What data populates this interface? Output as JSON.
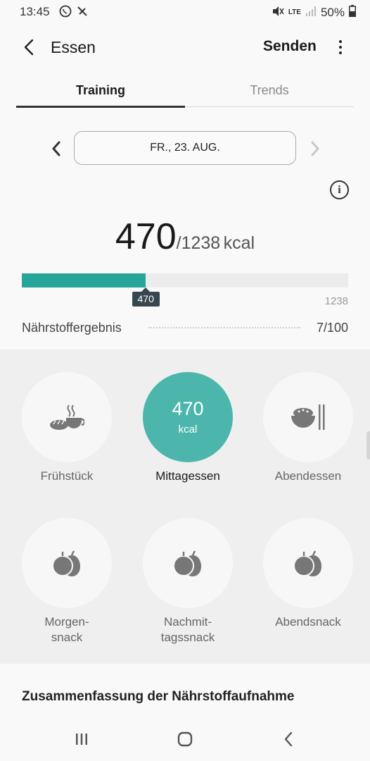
{
  "status_bar": {
    "time": "13:45",
    "battery": "50%",
    "network": "LTE"
  },
  "app_bar": {
    "title": "Essen",
    "send_label": "Senden"
  },
  "tabs": [
    {
      "label": "Training",
      "active": true
    },
    {
      "label": "Trends",
      "active": false
    }
  ],
  "date": {
    "label": "FR., 23. AUG."
  },
  "calories": {
    "consumed": "470",
    "goal": "/1238",
    "unit": "kcal",
    "marker_label": "470",
    "max_label": "1238",
    "progress_fraction": 0.38
  },
  "nutrient_score": {
    "label": "Nährstoffergebnis",
    "value": "7/100"
  },
  "meals": [
    {
      "label": "Frühstück",
      "icon": "breakfast-icon",
      "active": false
    },
    {
      "label": "Mittagessen",
      "icon": "lunch-icon",
      "active": true,
      "kcal": "470",
      "kcal_unit": "kcal"
    },
    {
      "label": "Abendessen",
      "icon": "dinner-bowl-icon",
      "active": false
    },
    {
      "label": "Morgen-\nsnack",
      "icon": "fruit-icon",
      "active": false
    },
    {
      "label": "Nachmit-\ntagssnack",
      "icon": "fruit-icon",
      "active": false
    },
    {
      "label": "Abendsnack",
      "icon": "fruit-icon",
      "active": false
    }
  ],
  "summary": {
    "title": "Zusammenfassung der Nährstoffaufnahme"
  },
  "colors": {
    "accent": "#26a69a",
    "active_circle": "#4db6ac",
    "marker": "#37474f"
  }
}
